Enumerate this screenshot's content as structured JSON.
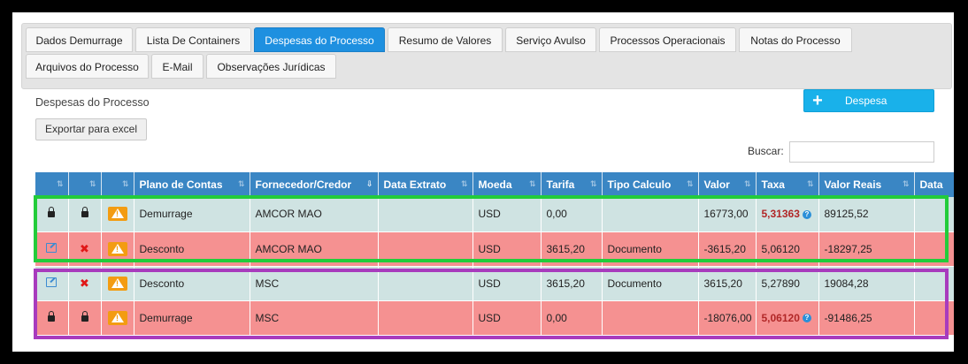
{
  "tabs": [
    {
      "label": "Dados Demurrage",
      "active": false
    },
    {
      "label": "Lista De Containers",
      "active": false
    },
    {
      "label": "Despesas do Processo",
      "active": true
    },
    {
      "label": "Resumo de Valores",
      "active": false
    },
    {
      "label": "Serviço Avulso",
      "active": false
    },
    {
      "label": "Processos Operacionais",
      "active": false
    },
    {
      "label": "Notas do Processo",
      "active": false
    },
    {
      "label": "Arquivos do Processo",
      "active": false
    },
    {
      "label": "E-Mail",
      "active": false
    },
    {
      "label": "Observações Jurídicas",
      "active": false
    }
  ],
  "section_title": "Despesas do Processo",
  "export_button": "Exportar para excel",
  "add_button": {
    "icon": "+",
    "label": "Despesa"
  },
  "search": {
    "label": "Buscar:",
    "value": ""
  },
  "table": {
    "columns": [
      "",
      "",
      "",
      "Plano de Contas",
      "Fornecedor/Credor",
      "Data Extrato",
      "Moeda",
      "Tarifa",
      "Tipo Calculo",
      "Valor",
      "Taxa",
      "Valor Reais",
      "Data"
    ],
    "rows": [
      {
        "style": "teal",
        "c1": "lock-icon",
        "c2": "lock-icon",
        "c3": "warning-icon",
        "plano": "Demurrage",
        "fornecedor": "AMCOR MAO",
        "extrato": "",
        "moeda": "USD",
        "tarifa": "0,00",
        "tipo": "",
        "valor": "16773,00",
        "taxa": "5,31363",
        "taxa_bold": true,
        "taxa_help": true,
        "valor_reais": "89125,52",
        "data": ""
      },
      {
        "style": "red",
        "c1": "edit-icon",
        "c2": "delete-icon",
        "c3": "warning-icon",
        "plano": "Desconto",
        "fornecedor": "AMCOR MAO",
        "extrato": "",
        "moeda": "USD",
        "tarifa": "3615,20",
        "tipo": "Documento",
        "valor": "-3615,20",
        "taxa": "5,06120",
        "taxa_bold": false,
        "taxa_help": false,
        "valor_reais": "-18297,25",
        "data": ""
      },
      {
        "style": "teal",
        "c1": "edit-icon",
        "c2": "delete-icon",
        "c3": "warning-icon",
        "plano": "Desconto",
        "fornecedor": "MSC",
        "extrato": "",
        "moeda": "USD",
        "tarifa": "3615,20",
        "tipo": "Documento",
        "valor": "3615,20",
        "taxa": "5,27890",
        "taxa_bold": false,
        "taxa_help": false,
        "valor_reais": "19084,28",
        "data": ""
      },
      {
        "style": "red",
        "c1": "lock-icon",
        "c2": "lock-icon",
        "c3": "warning-icon",
        "plano": "Demurrage",
        "fornecedor": "MSC",
        "extrato": "",
        "moeda": "USD",
        "tarifa": "0,00",
        "tipo": "",
        "valor": "-18076,00",
        "taxa": "5,06120",
        "taxa_bold": true,
        "taxa_help": true,
        "valor_reais": "-91486,25",
        "data": ""
      }
    ]
  },
  "colors": {
    "tab_active": "#1e90e0",
    "header": "#3a86c4",
    "row_teal": "#cfe3e2",
    "row_red": "#f59191",
    "highlight_green": "#22cc3a",
    "highlight_purple": "#a83bbd"
  }
}
